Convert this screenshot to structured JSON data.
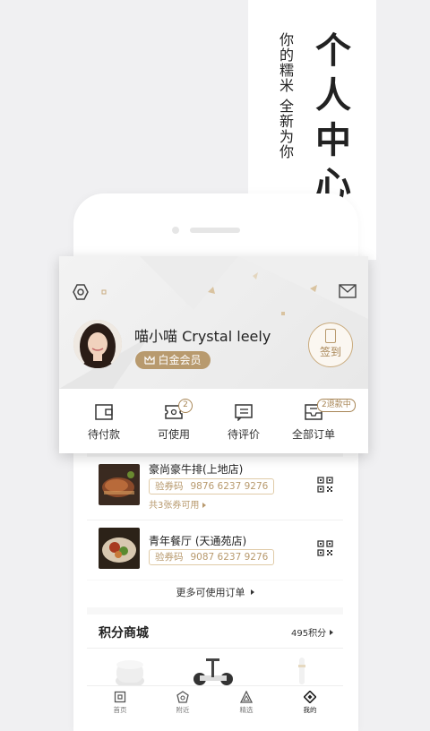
{
  "banner": {
    "title_chars": [
      "个",
      "人",
      "中",
      "心"
    ],
    "subtitle_col1": [
      "你",
      "的",
      "糯",
      "米"
    ],
    "subtitle_col2": [
      "全",
      "新",
      "为",
      "你"
    ]
  },
  "profile": {
    "username": "喵小喵 Crystal leely",
    "badge_label": "白金会员",
    "signin_label": "签到"
  },
  "orders": [
    {
      "label": "待付款"
    },
    {
      "label": "可使用",
      "count": "2"
    },
    {
      "label": "待评价"
    },
    {
      "label": "全部订单",
      "tag": "2退款中"
    }
  ],
  "coupons": [
    {
      "name": "豪尚豪牛排(上地店)",
      "code_label": "验券码",
      "code": "9876 6237 9276",
      "note": "共3张券可用"
    },
    {
      "name": "青年餐厅 (天通苑店)",
      "code_label": "验券码",
      "code": "9087 6237 9276",
      "note": ""
    }
  ],
  "more_orders_label": "更多可使用订单",
  "mall": {
    "title": "积分商城",
    "points": "495积分"
  },
  "tabs": [
    {
      "label": "首页",
      "icon": "home-icon"
    },
    {
      "label": "附近",
      "icon": "nearby-icon"
    },
    {
      "label": "精选",
      "icon": "featured-icon"
    },
    {
      "label": "我的",
      "icon": "me-icon"
    }
  ],
  "colors": {
    "accent": "#b89a6e",
    "text": "#333333"
  }
}
